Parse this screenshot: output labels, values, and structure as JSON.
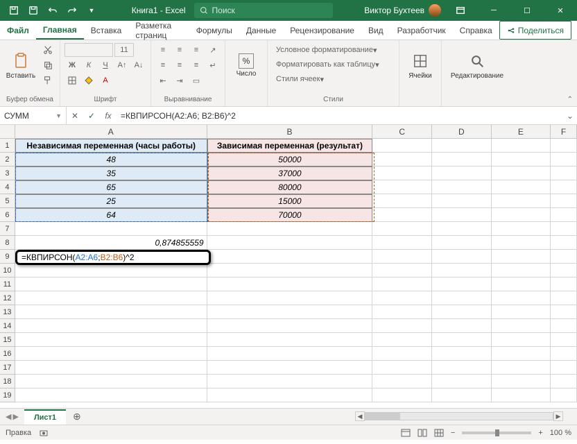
{
  "title": {
    "doc": "Книга1",
    "app": "Excel",
    "user": "Виктор Бухтеев"
  },
  "search": {
    "placeholder": "Поиск"
  },
  "menu": {
    "file": "Файл",
    "home": "Главная",
    "insert": "Вставка",
    "page": "Разметка страниц",
    "formulas": "Формулы",
    "data": "Данные",
    "review": "Рецензирование",
    "view": "Вид",
    "developer": "Разработчик",
    "help": "Справка",
    "share": "Поделиться"
  },
  "ribbon": {
    "clipboard": {
      "label": "Буфер обмена",
      "paste": "Вставить"
    },
    "font": {
      "label": "Шрифт",
      "size": "11",
      "bold": "Ж",
      "italic": "К",
      "underline": "Ч"
    },
    "align": {
      "label": "Выравнивание"
    },
    "number": {
      "label": "Число",
      "btn": "Число",
      "pct": "%"
    },
    "styles": {
      "label": "Стили",
      "cond": "Условное форматирование",
      "table": "Форматировать как таблицу",
      "cell": "Стили ячеек"
    },
    "cells": {
      "label": "Ячейки"
    },
    "editing": {
      "label": "Редактирование"
    }
  },
  "formula_bar": {
    "name_box": "СУММ",
    "formula": "=КВПИРСОН(A2:A6; B2:B6)^2"
  },
  "columns": [
    "A",
    "B",
    "C",
    "D",
    "E",
    "F"
  ],
  "headers": {
    "a": "Независимая переменная (часы работы)",
    "b": "Зависимая переменная (результат)"
  },
  "dataA": [
    "48",
    "35",
    "65",
    "25",
    "64"
  ],
  "dataB": [
    "50000",
    "37000",
    "80000",
    "15000",
    "70000"
  ],
  "a8": "0,874855559",
  "editing": {
    "pre": "=КВПИРСОН(",
    "r1": "A2:A6",
    "mid": "; ",
    "r2": "B2:B6",
    "post": ")^2"
  },
  "tabs": {
    "sheet1": "Лист1"
  },
  "status": {
    "mode": "Правка",
    "zoom": "100 %"
  }
}
